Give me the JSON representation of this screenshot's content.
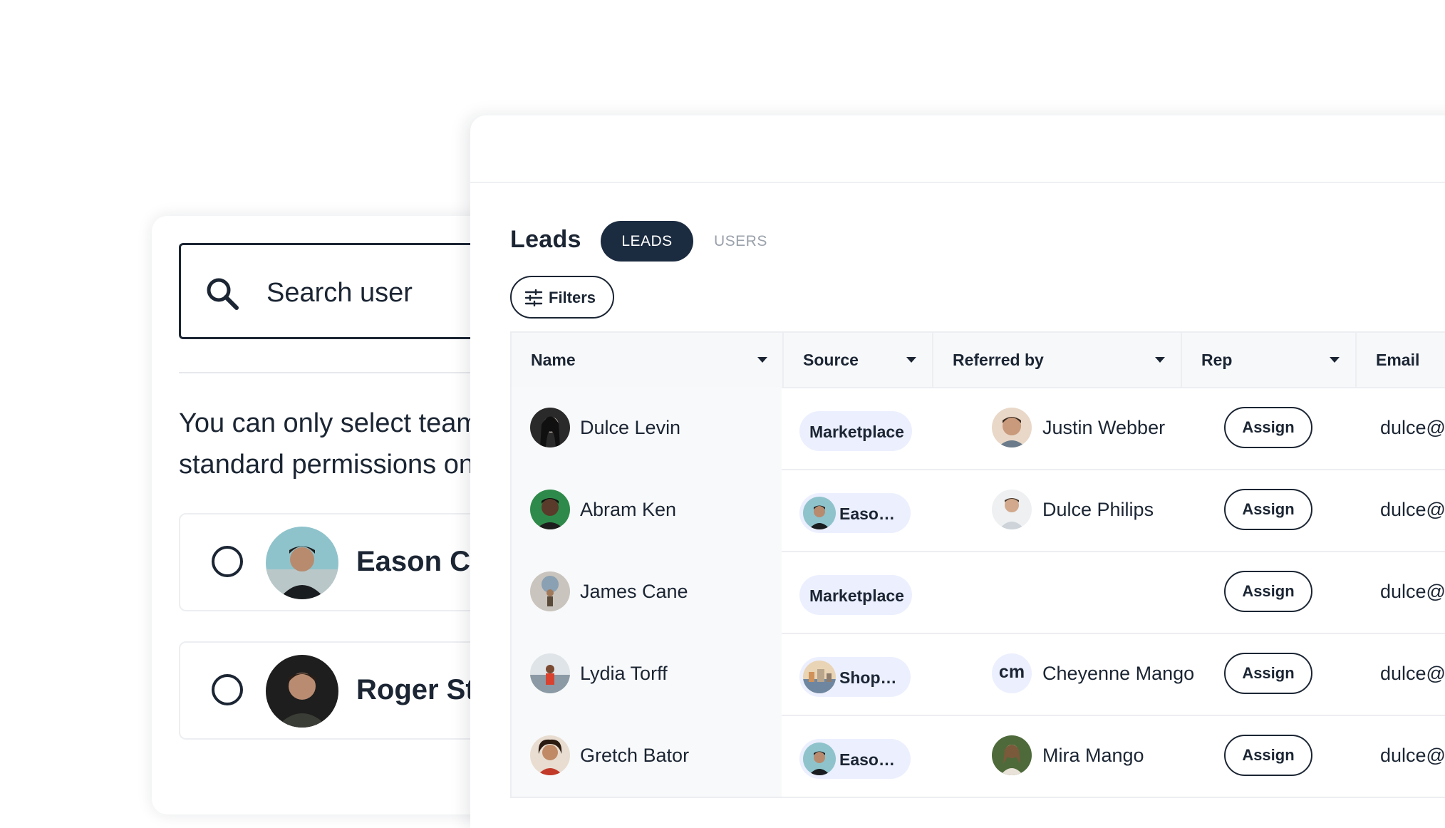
{
  "picker": {
    "search_placeholder": "Search user",
    "notice": "You can only select team members with standard permissions on your account.",
    "users": [
      {
        "name": "Eason Cooper"
      },
      {
        "name": "Roger Stanton"
      }
    ]
  },
  "leads": {
    "title": "Leads",
    "tabs": [
      {
        "label": "LEADS",
        "active": true
      },
      {
        "label": "USERS",
        "active": false
      }
    ],
    "filters_label": "Filters",
    "columns": [
      "Name",
      "Source",
      "Referred by",
      "Rep",
      "Email"
    ],
    "rows": [
      {
        "name": "Dulce Levin",
        "source": "Marketplace",
        "referred_by": "Justin Webber",
        "rep": "Assign",
        "email": "dulce@"
      },
      {
        "name": "Abram Ken",
        "source": "Easo…",
        "referred_by": "Dulce Philips",
        "rep": "Assign",
        "email": "dulce@"
      },
      {
        "name": "James Cane",
        "source": "Marketplace",
        "referred_by": "",
        "rep": "Assign",
        "email": "dulce@"
      },
      {
        "name": "Lydia Torff",
        "source": "Shop…",
        "referred_by": "Cheyenne Mango",
        "rep": "Assign",
        "email": "dulce@"
      },
      {
        "name": "Gretch Bator",
        "source": "Easo…",
        "referred_by": "Mira Mango",
        "rep": "Assign",
        "email": "dulce@"
      }
    ],
    "referrer_initials": "cm"
  },
  "colors": {
    "ink": "#1b2533",
    "tab_active_bg": "#1b2b40",
    "chip_bg": "#eceffe",
    "muted": "#9aa1aa"
  }
}
